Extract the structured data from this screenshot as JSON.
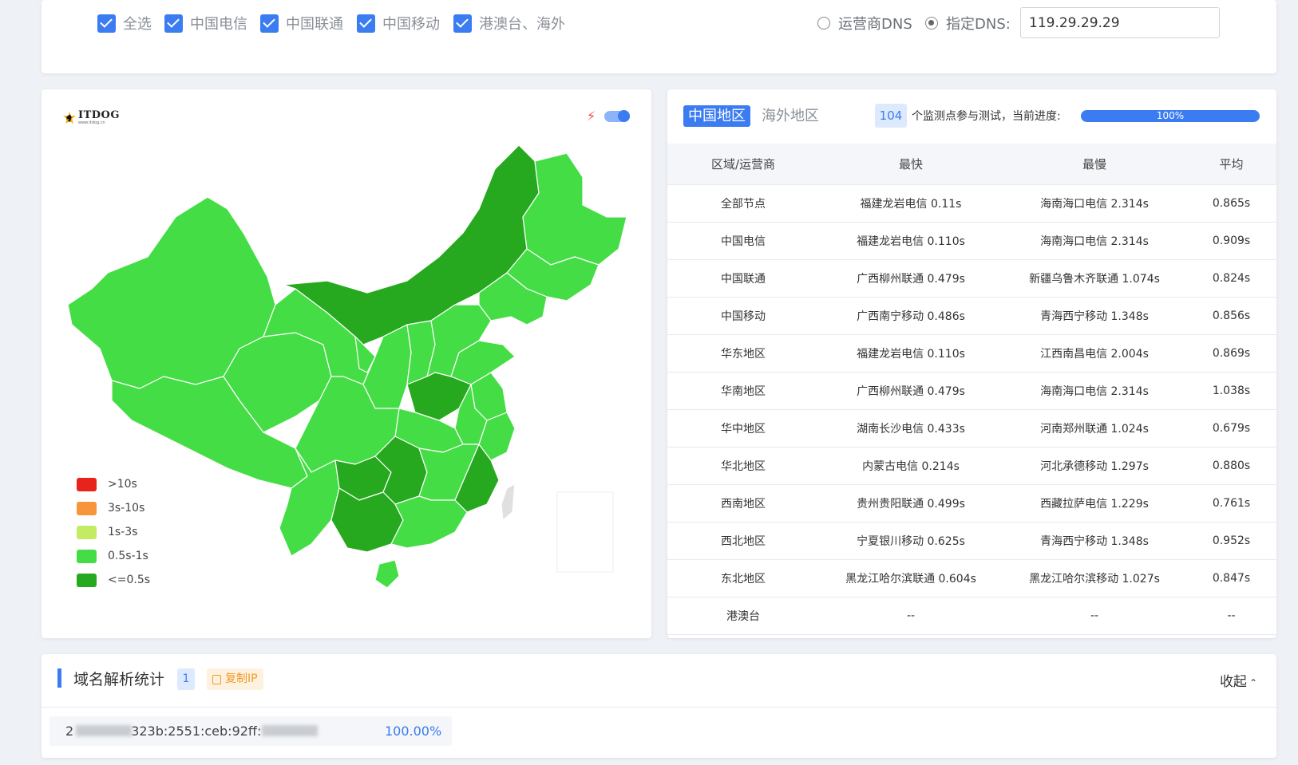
{
  "filters": {
    "checkboxes": [
      "全选",
      "中国电信",
      "中国联通",
      "中国移动",
      "港澳台、海外"
    ],
    "dns_radio_1": "运营商DNS",
    "dns_radio_2": "指定DNS:",
    "dns_value": "119.29.29.29"
  },
  "map": {
    "logo_brand": "ITDOG",
    "logo_url": "www.itdog.cn",
    "legend": [
      {
        "label": ">10s",
        "color": "#e8231c"
      },
      {
        "label": "3s-10s",
        "color": "#f7953a"
      },
      {
        "label": "1s-3s",
        "color": "#c3ec64"
      },
      {
        "label": "0.5s-1s",
        "color": "#45dd45"
      },
      {
        "label": "<=0.5s",
        "color": "#26a91f"
      }
    ]
  },
  "stats": {
    "tab_cn": "中国地区",
    "tab_overseas": "海外地区",
    "node_count": "104",
    "count_text": "个监测点参与测试，当前进度:",
    "progress": 1.0,
    "progress_label": "100%",
    "headers": [
      "区域/运营商",
      "最快",
      "最慢",
      "平均"
    ],
    "rows": [
      [
        "全部节点",
        "福建龙岩电信 0.11s",
        "海南海口电信 2.314s",
        "0.865s"
      ],
      [
        "中国电信",
        "福建龙岩电信 0.110s",
        "海南海口电信 2.314s",
        "0.909s"
      ],
      [
        "中国联通",
        "广西柳州联通 0.479s",
        "新疆乌鲁木齐联通 1.074s",
        "0.824s"
      ],
      [
        "中国移动",
        "广西南宁移动 0.486s",
        "青海西宁移动 1.348s",
        "0.856s"
      ],
      [
        "华东地区",
        "福建龙岩电信 0.110s",
        "江西南昌电信 2.004s",
        "0.869s"
      ],
      [
        "华南地区",
        "广西柳州联通 0.479s",
        "海南海口电信 2.314s",
        "1.038s"
      ],
      [
        "华中地区",
        "湖南长沙电信 0.433s",
        "河南郑州联通 1.024s",
        "0.679s"
      ],
      [
        "华北地区",
        "内蒙古电信 0.214s",
        "河北承德移动 1.297s",
        "0.880s"
      ],
      [
        "西南地区",
        "贵州贵阳联通 0.499s",
        "西藏拉萨电信 1.229s",
        "0.761s"
      ],
      [
        "西北地区",
        "宁夏银川移动 0.625s",
        "青海西宁移动 1.348s",
        "0.952s"
      ],
      [
        "东北地区",
        "黑龙江哈尔滨联通 0.604s",
        "黑龙江哈尔滨移动 1.027s",
        "0.847s"
      ],
      [
        "港澳台",
        "--",
        "--",
        "--"
      ]
    ]
  },
  "resolve": {
    "title": "域名解析统计",
    "count": "1",
    "copy_label": "复制IP",
    "collapse_label": "收起",
    "ip_prefix": "2",
    "ip_middle": "323b:2551:ceb:92ff:",
    "percent": "100.00%"
  }
}
